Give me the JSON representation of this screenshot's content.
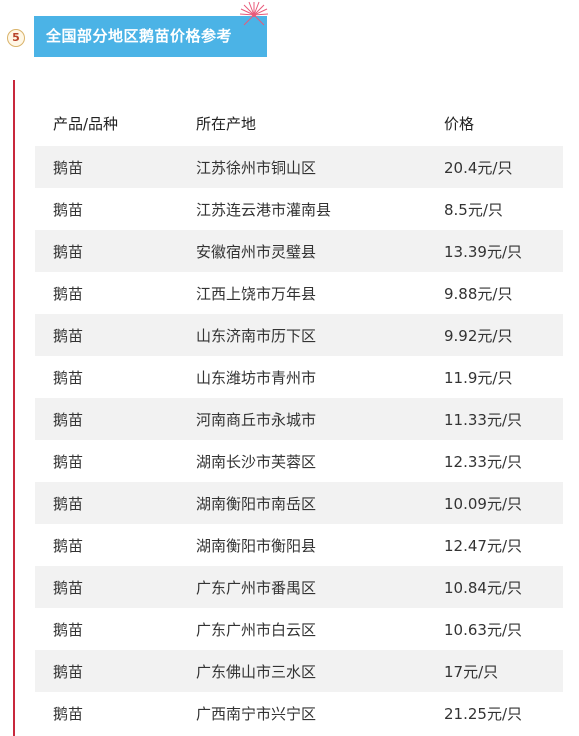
{
  "section": {
    "number": "5",
    "title": "全国部分地区鹅苗价格参考"
  },
  "table": {
    "headers": [
      "产品/品种",
      "所在产地",
      "价格"
    ],
    "rows": [
      [
        "鹅苗",
        "江苏徐州市铜山区",
        "20.4元/只"
      ],
      [
        "鹅苗",
        "江苏连云港市灌南县",
        "8.5元/只"
      ],
      [
        "鹅苗",
        "安徽宿州市灵璧县",
        "13.39元/只"
      ],
      [
        "鹅苗",
        "江西上饶市万年县",
        "9.88元/只"
      ],
      [
        "鹅苗",
        "山东济南市历下区",
        "9.92元/只"
      ],
      [
        "鹅苗",
        "山东潍坊市青州市",
        "11.9元/只"
      ],
      [
        "鹅苗",
        "河南商丘市永城市",
        "11.33元/只"
      ],
      [
        "鹅苗",
        "湖南长沙市芙蓉区",
        "12.33元/只"
      ],
      [
        "鹅苗",
        "湖南衡阳市南岳区",
        "10.09元/只"
      ],
      [
        "鹅苗",
        "湖南衡阳市衡阳县",
        "12.47元/只"
      ],
      [
        "鹅苗",
        "广东广州市番禺区",
        "10.84元/只"
      ],
      [
        "鹅苗",
        "广东广州市白云区",
        "10.63元/只"
      ],
      [
        "鹅苗",
        "广东佛山市三水区",
        "17元/只"
      ],
      [
        "鹅苗",
        "广西南宁市兴宁区",
        "21.25元/只"
      ]
    ]
  },
  "colors": {
    "title_bg": "#4bb3e6",
    "accent_line": "#c8283c",
    "row_alt": "#f2f2f2"
  },
  "icons": {
    "burst": "firework-burst-icon"
  }
}
